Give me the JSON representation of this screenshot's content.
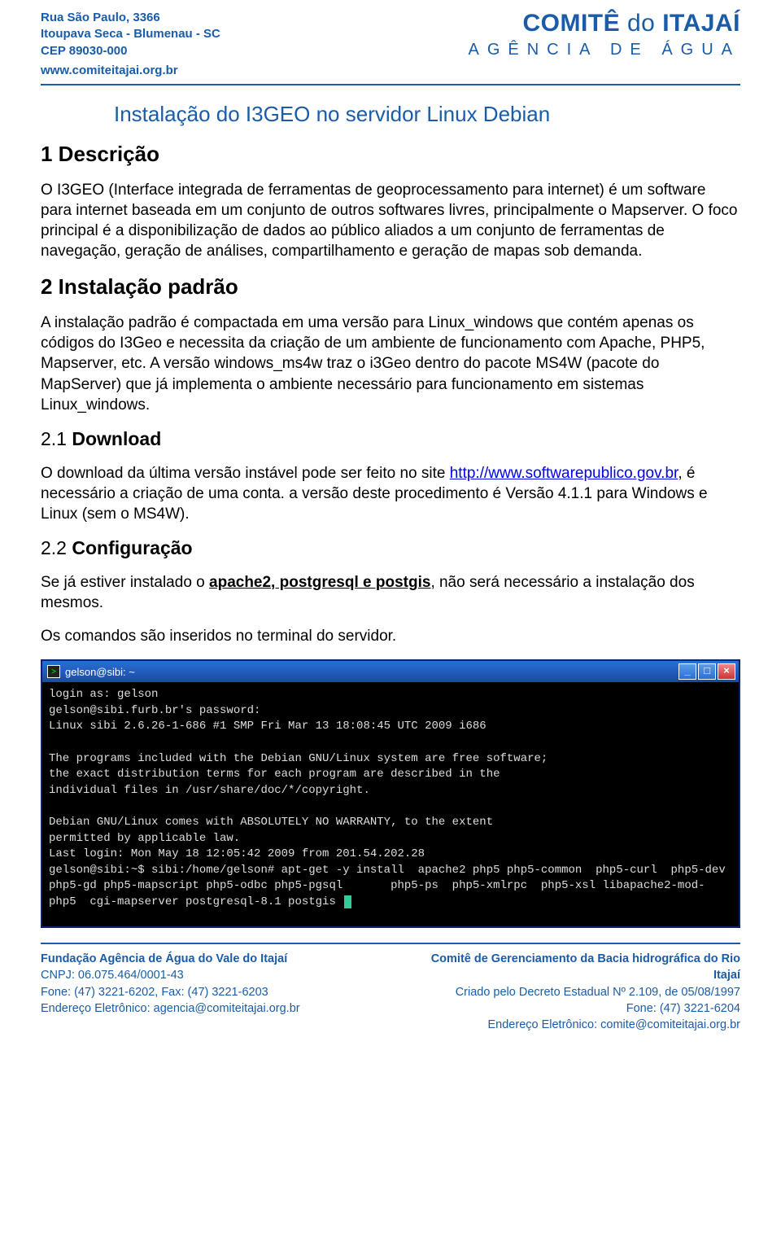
{
  "header": {
    "street": "Rua São Paulo, 3366",
    "city": "Itoupava Seca - Blumenau - SC",
    "cep": "CEP 89030-000",
    "site": "www.comiteitajai.org.br",
    "logo_heavy": "COMITÊ",
    "logo_do": "do",
    "logo_light": "ITAJAÍ",
    "logo_sub": "AGÊNCIA DE ÁGUA"
  },
  "doc": {
    "title": "Instalação do I3GEO no servidor Linux Debian",
    "sec1_h": "1  Descrição",
    "sec1_p": "O I3GEO (Interface integrada de ferramentas de geoprocessamento para internet) é um software para internet baseada em um conjunto de outros softwares livres, principalmente o Mapserver. O foco principal é a disponibilização de dados ao público aliados a um conjunto de ferramentas de navegação, geração de análises, compartilhamento e geração de mapas sob demanda.",
    "sec2_h": "2  Instalação padrão",
    "sec2_p": "A instalação padrão é compactada em uma versão para Linux_windows que contém apenas os códigos do I3Geo e necessita da criação de um ambiente de funcionamento com Apache, PHP5, Mapserver, etc. A versão windows_ms4w traz o i3Geo dentro do pacote MS4W (pacote do MapServer) que já implementa o ambiente necessário para funcionamento em sistemas Linux_windows.",
    "sec21_num": "2.1",
    "sec21_h": "Download",
    "sec21_p_before": "O download da última versão instável pode ser feito no site ",
    "sec21_link": "http://www.softwarepublico.gov.br",
    "sec21_p_after": ", é necessário a criação de uma conta. a versão deste procedimento é Versão 4.1.1 para Windows e Linux (sem o MS4W).",
    "sec22_num": "2.2",
    "sec22_h": "Configuração",
    "sec22_p1_before": "Se já estiver instalado o ",
    "sec22_p1_bold": "apache2, postgresql e postgis",
    "sec22_p1_after": ", não será necessário a instalação dos mesmos.",
    "sec22_p2": "Os comandos são inseridos no terminal do servidor."
  },
  "terminal": {
    "title": "gelson@sibi: ~",
    "lines": "login as: gelson\ngelson@sibi.furb.br's password:\nLinux sibi 2.6.26-1-686 #1 SMP Fri Mar 13 18:08:45 UTC 2009 i686\n\nThe programs included with the Debian GNU/Linux system are free software;\nthe exact distribution terms for each program are described in the\nindividual files in /usr/share/doc/*/copyright.\n\nDebian GNU/Linux comes with ABSOLUTELY NO WARRANTY, to the extent\npermitted by applicable law.\nLast login: Mon May 18 12:05:42 2009 from 201.54.202.28\ngelson@sibi:~$ sibi:/home/gelson# apt-get -y install  apache2 php5 php5-common  php5-curl  php5-dev php5-gd php5-mapscript php5-odbc php5-pgsql       php5-ps  php5-xmlrpc  php5-xsl libapache2-mod-php5  cgi-mapserver postgresql-8.1 postgis "
  },
  "footer": {
    "left_title": "Fundação Agência de Água do Vale do Itajaí",
    "cnpj": "CNPJ: 06.075.464/0001-43",
    "phones_left": "Fone: (47) 3221-6202, Fax: (47) 3221-6203",
    "email_left": "Endereço Eletrônico: agencia@comiteitajai.org.br",
    "right_title": "Comitê de Gerenciamento da Bacia hidrográfica do Rio Itajaí",
    "decree": "Criado pelo Decreto Estadual Nº 2.109, de 05/08/1997",
    "phone_right": "Fone: (47) 3221-6204",
    "email_right": "Endereço Eletrônico: comite@comiteitajai.org.br"
  }
}
